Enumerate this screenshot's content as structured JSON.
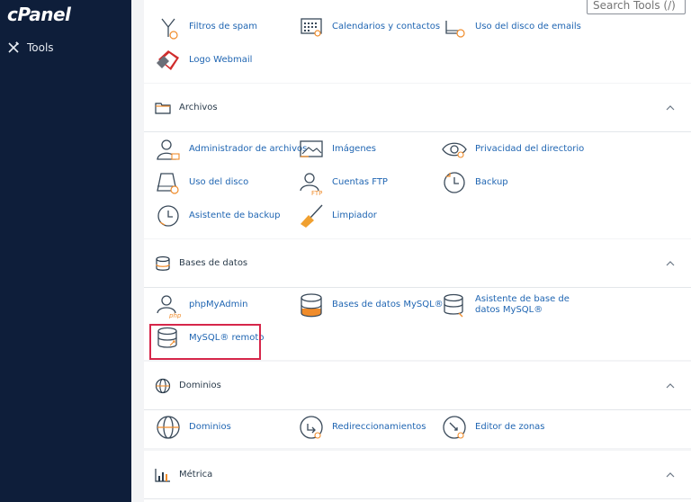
{
  "sidebar": {
    "logo": "cPanel",
    "tools_label": "Tools"
  },
  "search": {
    "placeholder": "Search Tools (/)"
  },
  "email_partial": {
    "items": [
      "Filtros de spam",
      "Calendarios y contactos",
      "Uso del disco de emails",
      "Logo Webmail"
    ]
  },
  "archivos": {
    "title": "Archivos",
    "items": [
      "Administrador de archivos",
      "Imágenes",
      "Privacidad del directorio",
      "Uso del disco",
      "Cuentas FTP",
      "Backup",
      "Asistente de backup",
      "Limpiador"
    ]
  },
  "bases": {
    "title": "Bases de datos",
    "items": [
      "phpMyAdmin",
      "Bases de datos MySQL®",
      "Asistente de base de datos MySQL®",
      "MySQL® remoto"
    ]
  },
  "dominios": {
    "title": "Dominios",
    "items": [
      "Dominios",
      "Redireccionamientos",
      "Editor de zonas"
    ]
  },
  "metrica": {
    "title": "Métrica"
  },
  "colors": {
    "sidebar": "#0e1e3a",
    "link": "#1f65b2",
    "accent": "#f08c2b",
    "highlight": "#d6264a"
  }
}
